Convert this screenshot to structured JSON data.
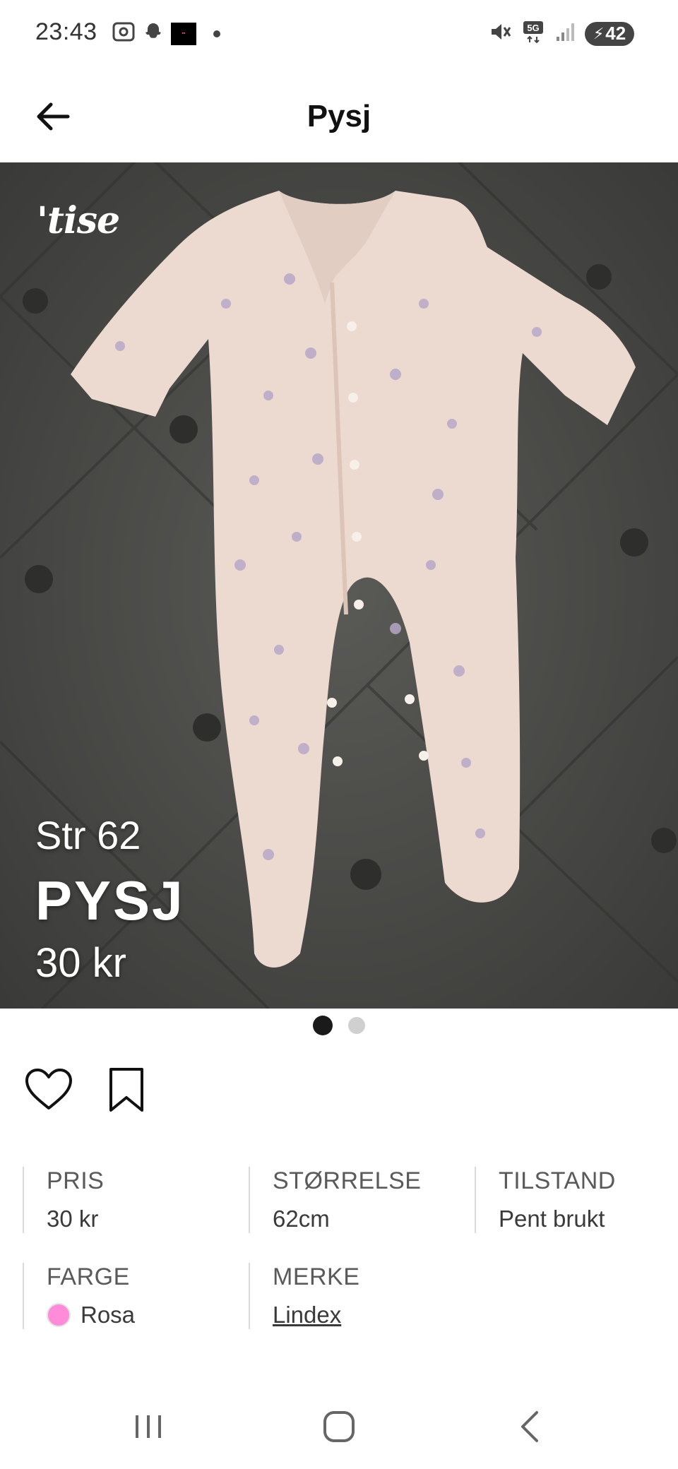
{
  "status_bar": {
    "time": "23:43",
    "battery": "42",
    "network": "5G",
    "icons": [
      "screenshot-icon",
      "snapchat-icon",
      "app-thumbnail",
      "notification-dot",
      "mute-icon",
      "network-5g-icon",
      "signal-icon",
      "battery-charging-icon"
    ]
  },
  "header": {
    "title": "Pysj",
    "back_icon": "arrow-left-icon"
  },
  "photo": {
    "watermark": "'tise",
    "overlay": {
      "size": "Str 62",
      "title": "PYSJ",
      "price": "30 kr"
    }
  },
  "carousel": {
    "count": 2,
    "active": 0
  },
  "actions": [
    "heart-icon",
    "bookmark-icon"
  ],
  "attributes": [
    {
      "label": "PRIS",
      "value": "30 kr"
    },
    {
      "label": "STØRRELSE",
      "value": "62cm"
    },
    {
      "label": "TILSTAND",
      "value": "Pent brukt"
    },
    {
      "label": "FARGE",
      "value": "Rosa",
      "swatch": "#ff8bd9"
    },
    {
      "label": "MERKE",
      "value": "Lindex",
      "link": true
    }
  ],
  "nav": [
    "recent-apps-icon",
    "home-icon",
    "back-icon"
  ]
}
